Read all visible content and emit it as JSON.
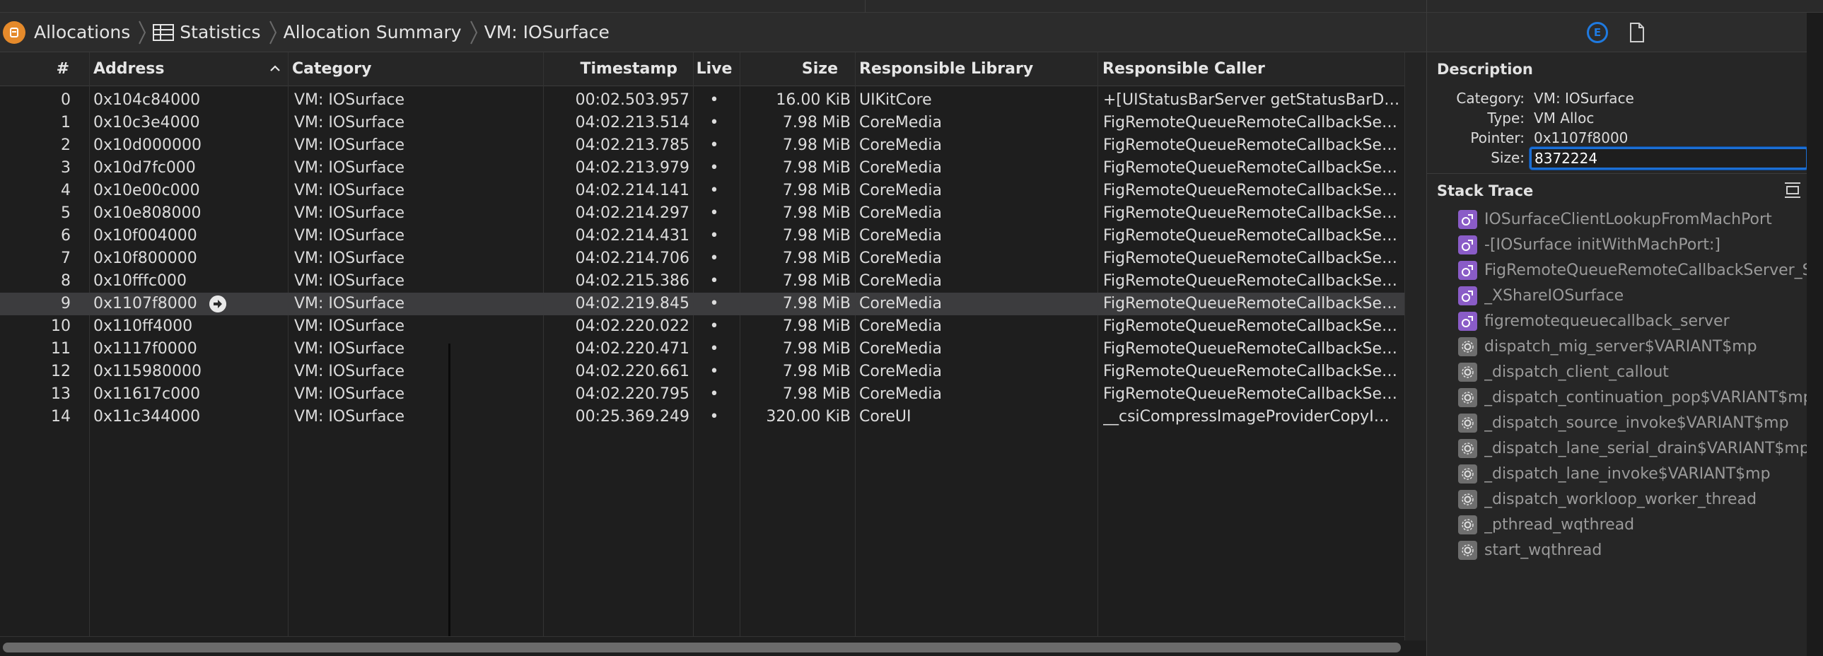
{
  "breadcrumb": {
    "items": [
      "Allocations",
      "Statistics",
      "Allocation Summary",
      "VM: IOSurface"
    ]
  },
  "table": {
    "headers": {
      "num": "#",
      "address": "Address",
      "category": "Category",
      "timestamp": "Timestamp",
      "live": "Live",
      "size": "Size",
      "library": "Responsible Library",
      "caller": "Responsible Caller"
    },
    "sort_column": "Address",
    "sort_direction": "ascending",
    "rows": [
      {
        "num": "0",
        "address": "0x104c84000",
        "category": "VM: IOSurface",
        "timestamp": "00:02.503.957",
        "live": "•",
        "size": "16.00 KiB",
        "library": "UIKitCore",
        "caller": "+[UIStatusBarServer getStatusBarData]"
      },
      {
        "num": "1",
        "address": "0x10c3e4000",
        "category": "VM: IOSurface",
        "timestamp": "04:02.213.514",
        "live": "•",
        "size": "7.98 MiB",
        "library": "CoreMedia",
        "caller": "FigRemoteQueueRemoteCallbackServ..."
      },
      {
        "num": "2",
        "address": "0x10d000000",
        "category": "VM: IOSurface",
        "timestamp": "04:02.213.785",
        "live": "•",
        "size": "7.98 MiB",
        "library": "CoreMedia",
        "caller": "FigRemoteQueueRemoteCallbackServ..."
      },
      {
        "num": "3",
        "address": "0x10d7fc000",
        "category": "VM: IOSurface",
        "timestamp": "04:02.213.979",
        "live": "•",
        "size": "7.98 MiB",
        "library": "CoreMedia",
        "caller": "FigRemoteQueueRemoteCallbackServ..."
      },
      {
        "num": "4",
        "address": "0x10e00c000",
        "category": "VM: IOSurface",
        "timestamp": "04:02.214.141",
        "live": "•",
        "size": "7.98 MiB",
        "library": "CoreMedia",
        "caller": "FigRemoteQueueRemoteCallbackServ..."
      },
      {
        "num": "5",
        "address": "0x10e808000",
        "category": "VM: IOSurface",
        "timestamp": "04:02.214.297",
        "live": "•",
        "size": "7.98 MiB",
        "library": "CoreMedia",
        "caller": "FigRemoteQueueRemoteCallbackServ..."
      },
      {
        "num": "6",
        "address": "0x10f004000",
        "category": "VM: IOSurface",
        "timestamp": "04:02.214.431",
        "live": "•",
        "size": "7.98 MiB",
        "library": "CoreMedia",
        "caller": "FigRemoteQueueRemoteCallbackServ..."
      },
      {
        "num": "7",
        "address": "0x10f800000",
        "category": "VM: IOSurface",
        "timestamp": "04:02.214.706",
        "live": "•",
        "size": "7.98 MiB",
        "library": "CoreMedia",
        "caller": "FigRemoteQueueRemoteCallbackServ..."
      },
      {
        "num": "8",
        "address": "0x10fffc000",
        "category": "VM: IOSurface",
        "timestamp": "04:02.215.386",
        "live": "•",
        "size": "7.98 MiB",
        "library": "CoreMedia",
        "caller": "FigRemoteQueueRemoteCallbackServ..."
      },
      {
        "num": "9",
        "address": "0x1107f8000",
        "category": "VM: IOSurface",
        "timestamp": "04:02.219.845",
        "live": "•",
        "size": "7.98 MiB",
        "library": "CoreMedia",
        "caller": "FigRemoteQueueRemoteCallbackServ...",
        "selected": true
      },
      {
        "num": "10",
        "address": "0x110ff4000",
        "category": "VM: IOSurface",
        "timestamp": "04:02.220.022",
        "live": "•",
        "size": "7.98 MiB",
        "library": "CoreMedia",
        "caller": "FigRemoteQueueRemoteCallbackServ..."
      },
      {
        "num": "11",
        "address": "0x1117f0000",
        "category": "VM: IOSurface",
        "timestamp": "04:02.220.471",
        "live": "•",
        "size": "7.98 MiB",
        "library": "CoreMedia",
        "caller": "FigRemoteQueueRemoteCallbackServ..."
      },
      {
        "num": "12",
        "address": "0x115980000",
        "category": "VM: IOSurface",
        "timestamp": "04:02.220.661",
        "live": "•",
        "size": "7.98 MiB",
        "library": "CoreMedia",
        "caller": "FigRemoteQueueRemoteCallbackServ..."
      },
      {
        "num": "13",
        "address": "0x11617c000",
        "category": "VM: IOSurface",
        "timestamp": "04:02.220.795",
        "live": "•",
        "size": "7.98 MiB",
        "library": "CoreMedia",
        "caller": "FigRemoteQueueRemoteCallbackServ..."
      },
      {
        "num": "14",
        "address": "0x11c344000",
        "category": "VM: IOSurface",
        "timestamp": "00:25.369.249",
        "live": "•",
        "size": "320.00 KiB",
        "library": "CoreUI",
        "caller": "__csiCompressImageProviderCopyIOS..."
      }
    ]
  },
  "inspector": {
    "tabs": {
      "extended_detail_icon_letter": "E"
    },
    "description": {
      "title": "Description",
      "fields": [
        {
          "label": "Category:",
          "value": "VM: IOSurface"
        },
        {
          "label": "Type:",
          "value": "VM Alloc"
        },
        {
          "label": "Pointer:",
          "value": "0x1107f8000"
        }
      ],
      "size_label": "Size:",
      "size_value": "8372224"
    },
    "stack_trace": {
      "title": "Stack Trace",
      "frames": [
        {
          "name": "IOSurfaceClientLookupFromMachPort",
          "kind": "user"
        },
        {
          "name": "-[IOSurface initWithMachPort:]",
          "kind": "user"
        },
        {
          "name": "FigRemoteQueueRemoteCallbackServer_Sl",
          "kind": "user"
        },
        {
          "name": "_XShareIOSurface",
          "kind": "user"
        },
        {
          "name": "figremotequeuecallback_server",
          "kind": "user"
        },
        {
          "name": "dispatch_mig_server$VARIANT$mp",
          "kind": "system"
        },
        {
          "name": "_dispatch_client_callout",
          "kind": "system"
        },
        {
          "name": "_dispatch_continuation_pop$VARIANT$mp",
          "kind": "system"
        },
        {
          "name": "_dispatch_source_invoke$VARIANT$mp",
          "kind": "system"
        },
        {
          "name": "_dispatch_lane_serial_drain$VARIANT$mp",
          "kind": "system"
        },
        {
          "name": "_dispatch_lane_invoke$VARIANT$mp",
          "kind": "system"
        },
        {
          "name": "_dispatch_workloop_worker_thread",
          "kind": "system"
        },
        {
          "name": "_pthread_wqthread",
          "kind": "system"
        },
        {
          "name": "start_wqthread",
          "kind": "system"
        }
      ]
    }
  },
  "colors": {
    "accent": "#1f7ae0",
    "allocations_icon": "#e58a2b",
    "user_frame_icon": "#8a5cc7",
    "system_frame_icon": "#6e6e6e",
    "selected_row": "#3c3c3e"
  },
  "icons": [
    "allocations-icon",
    "statistics-table-icon",
    "chevron-right-icon",
    "sort-ascending-icon",
    "go-to-arrow-icon",
    "extended-detail-icon",
    "file-icon",
    "expand-stack-icon",
    "user-frame-icon",
    "system-frame-icon"
  ]
}
